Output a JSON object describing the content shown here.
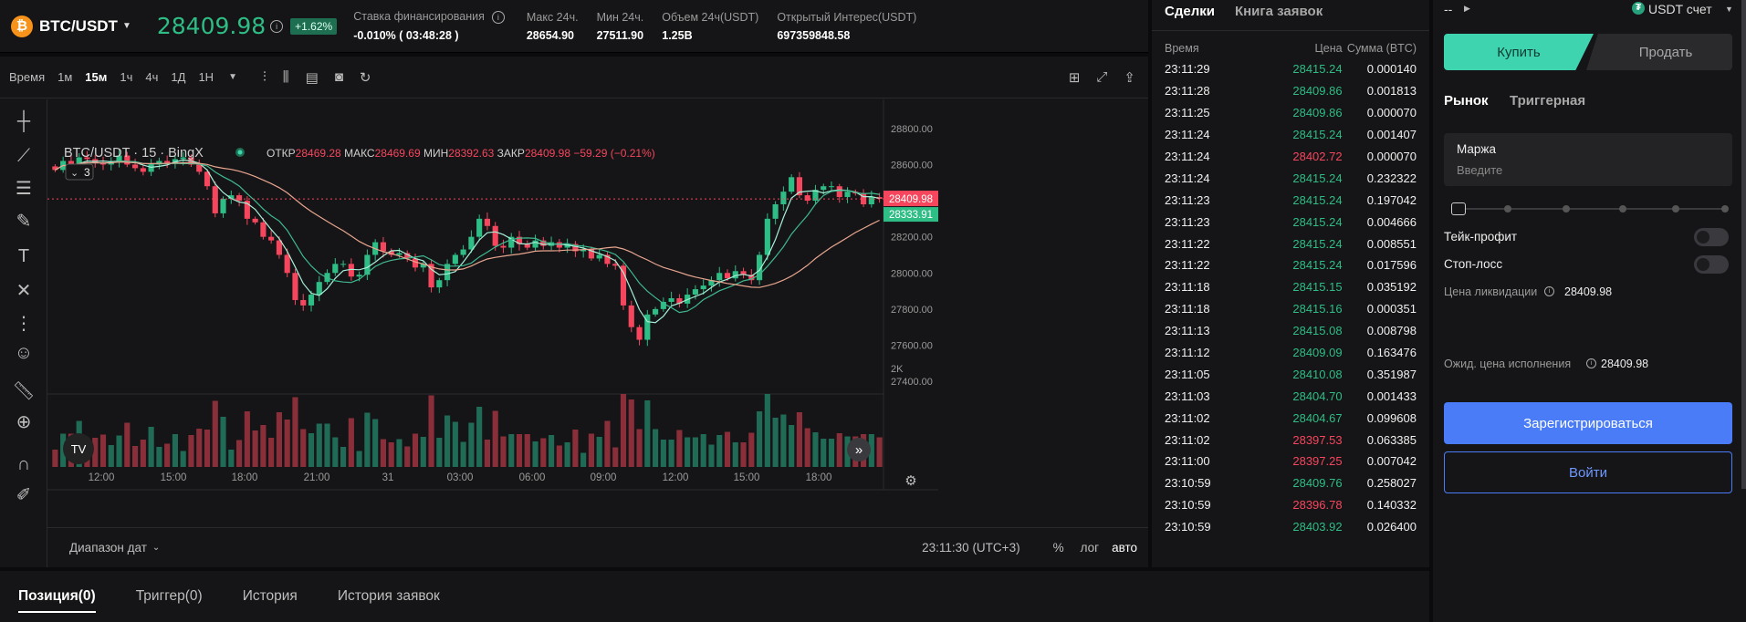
{
  "header": {
    "pair": "BTC/USDT",
    "last_price": "28409.98",
    "change_pct": "+1.62%",
    "stats": [
      {
        "label": "Ставка финансирования",
        "value": "-0.010%  ( 03:48:28 )",
        "info": true
      },
      {
        "label": "Макс 24ч.",
        "value": "28654.90"
      },
      {
        "label": "Мин 24ч.",
        "value": "27511.90"
      },
      {
        "label": "Объем 24ч(USDT)",
        "value": "1.25B"
      },
      {
        "label": "Открытый Интерес(USDT)",
        "value": "697359848.58"
      }
    ]
  },
  "toolbar": {
    "time_label": "Время",
    "timeframes": [
      "1м",
      "15м",
      "1ч",
      "4ч",
      "1Д",
      "1Н"
    ],
    "active_timeframe": "15м"
  },
  "chart": {
    "legend_symbol": "BTC/USDT · 15 · BingX",
    "ohlc": {
      "o_label": "ОТКР",
      "o": "28469.28",
      "h_label": "МАКС",
      "h": "28469.69",
      "l_label": "МИН",
      "l": "28392.63",
      "c_label": "ЗАКР",
      "c": "28409.98",
      "change": "−59.29 (−0.21%)"
    },
    "indicator_count": "3",
    "last_price_tag": "28409.98",
    "mark_price_tag": "28333.91",
    "volume_tick": "2K",
    "date_range_label": "Диапазон дат",
    "clock": "23:11:30 (UTC+3)",
    "scale_percent": "%",
    "scale_log": "лог",
    "scale_auto": "авто",
    "logo": "TV"
  },
  "chart_data": {
    "type": "candlestick",
    "y_ticks": [
      28800,
      28600,
      28400,
      28200,
      28000,
      27800,
      27600,
      27400
    ],
    "y_tick_labels": [
      "28800.00",
      "28600.00",
      "28400.00",
      "28200.00",
      "28000.00",
      "27800.00",
      "27600.00",
      "27400.00"
    ],
    "ylim": [
      27350,
      28890
    ],
    "x_tick_labels": [
      "12:00",
      "15:00",
      "18:00",
      "21:00",
      "31",
      "03:00",
      "06:00",
      "09:00",
      "12:00",
      "15:00",
      "18:00"
    ],
    "close_path": [
      28570,
      28620,
      28590,
      28640,
      28630,
      28610,
      28600,
      28620,
      28650,
      28600,
      28580,
      28560,
      28600,
      28620,
      28610,
      28630,
      28640,
      28600,
      28560,
      28480,
      28330,
      28410,
      28430,
      28400,
      28300,
      28280,
      28200,
      28180,
      28100,
      28000,
      27850,
      27820,
      27880,
      27950,
      28000,
      28050,
      28050,
      27980,
      27990,
      28100,
      28170,
      28120,
      28100,
      28110,
      28080,
      28030,
      28050,
      27920,
      27960,
      28050,
      28100,
      28130,
      28200,
      28300,
      28260,
      28150,
      28140,
      28200,
      28160,
      28140,
      28180,
      28150,
      28170,
      28140,
      28160,
      28120,
      28130,
      28080,
      28100,
      28050,
      28040,
      27820,
      27700,
      27630,
      27770,
      27800,
      27840,
      27860,
      27830,
      27880,
      27910,
      27930,
      27960,
      28000,
      27970,
      28010,
      27990,
      27960,
      28100,
      28300,
      28380,
      28450,
      28530,
      28430,
      28400,
      28460,
      28480,
      28480,
      28420,
      28450,
      28440,
      28380,
      28420,
      28410
    ],
    "volume_peaks": [
      0.2,
      0.15,
      0.3,
      0.25,
      0.18,
      0.3,
      0.35,
      0.4,
      0.3,
      0.25
    ]
  },
  "trades": {
    "tabs": [
      "Сделки",
      "Книга заявок"
    ],
    "columns": [
      "Время",
      "Цена",
      "Сумма (BTC)"
    ],
    "rows": [
      {
        "t": "23:11:29",
        "p": "28415.24",
        "a": "0.000140",
        "s": "up"
      },
      {
        "t": "23:11:28",
        "p": "28409.86",
        "a": "0.001813",
        "s": "up"
      },
      {
        "t": "23:11:25",
        "p": "28409.86",
        "a": "0.000070",
        "s": "up"
      },
      {
        "t": "23:11:24",
        "p": "28415.24",
        "a": "0.001407",
        "s": "up"
      },
      {
        "t": "23:11:24",
        "p": "28402.72",
        "a": "0.000070",
        "s": "dn"
      },
      {
        "t": "23:11:24",
        "p": "28415.24",
        "a": "0.232322",
        "s": "up"
      },
      {
        "t": "23:11:23",
        "p": "28415.24",
        "a": "0.197042",
        "s": "up"
      },
      {
        "t": "23:11:23",
        "p": "28415.24",
        "a": "0.004666",
        "s": "up"
      },
      {
        "t": "23:11:22",
        "p": "28415.24",
        "a": "0.008551",
        "s": "up"
      },
      {
        "t": "23:11:22",
        "p": "28415.24",
        "a": "0.017596",
        "s": "up"
      },
      {
        "t": "23:11:18",
        "p": "28415.15",
        "a": "0.035192",
        "s": "up"
      },
      {
        "t": "23:11:18",
        "p": "28415.16",
        "a": "0.000351",
        "s": "up"
      },
      {
        "t": "23:11:13",
        "p": "28415.08",
        "a": "0.008798",
        "s": "up"
      },
      {
        "t": "23:11:12",
        "p": "28409.09",
        "a": "0.163476",
        "s": "up"
      },
      {
        "t": "23:11:05",
        "p": "28410.08",
        "a": "0.351987",
        "s": "up"
      },
      {
        "t": "23:11:03",
        "p": "28404.70",
        "a": "0.001433",
        "s": "up"
      },
      {
        "t": "23:11:02",
        "p": "28404.67",
        "a": "0.099608",
        "s": "up"
      },
      {
        "t": "23:11:02",
        "p": "28397.53",
        "a": "0.063385",
        "s": "dn"
      },
      {
        "t": "23:11:00",
        "p": "28397.25",
        "a": "0.007042",
        "s": "dn"
      },
      {
        "t": "23:10:59",
        "p": "28409.76",
        "a": "0.258027",
        "s": "up"
      },
      {
        "t": "23:10:59",
        "p": "28396.78",
        "a": "0.140332",
        "s": "dn"
      },
      {
        "t": "23:10:59",
        "p": "28403.92",
        "a": "0.026400",
        "s": "up"
      }
    ]
  },
  "order": {
    "account_left": "--",
    "account_right": "USDT счет",
    "buy": "Купить",
    "sell": "Продать",
    "tabs": [
      "Рынок",
      "Триггерная"
    ],
    "margin_label": "Маржа",
    "margin_placeholder": "Введите",
    "take_profit": "Тейк-профит",
    "stop_loss": "Стоп-лосс",
    "liq_label": "Цена ликвидации",
    "liq_value": "28409.98",
    "exp_label": "Ожид. цена исполнения",
    "exp_value": "28409.98",
    "register": "Зарегистрироваться",
    "login": "Войти"
  },
  "positions": {
    "tabs": [
      "Позиция(0)",
      "Триггер(0)",
      "История",
      "История заявок"
    ]
  },
  "colors": {
    "up": "#2ebd85",
    "down": "#f6465d",
    "accent": "#3fd4b0",
    "primary": "#4a7cf7"
  }
}
